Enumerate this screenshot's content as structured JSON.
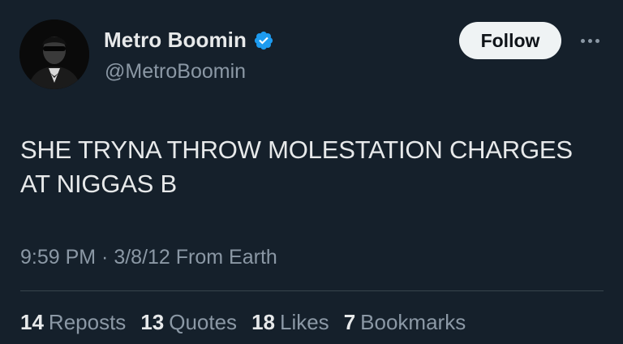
{
  "author": {
    "display_name": "Metro Boomin",
    "handle": "@MetroBoomin",
    "verified": true,
    "avatar_icon": "profile-photo"
  },
  "actions": {
    "follow_label": "Follow",
    "more_icon": "more-horizontal-icon"
  },
  "tweet": {
    "text": "SHE TRYNA THROW MOLESTATION CHARGES\nAT NIGGAS B",
    "meta": "9:59 PM · 3/8/12 From Earth"
  },
  "stats": [
    {
      "count": "14",
      "label": "Reposts"
    },
    {
      "count": "13",
      "label": "Quotes"
    },
    {
      "count": "18",
      "label": "Likes"
    },
    {
      "count": "7",
      "label": "Bookmarks"
    }
  ],
  "colors": {
    "background": "#15202b",
    "text": "#e7e9ea",
    "secondary_text": "#8b98a5",
    "verified_badge": "#1d9bf0",
    "follow_button_bg": "#eff3f4"
  }
}
